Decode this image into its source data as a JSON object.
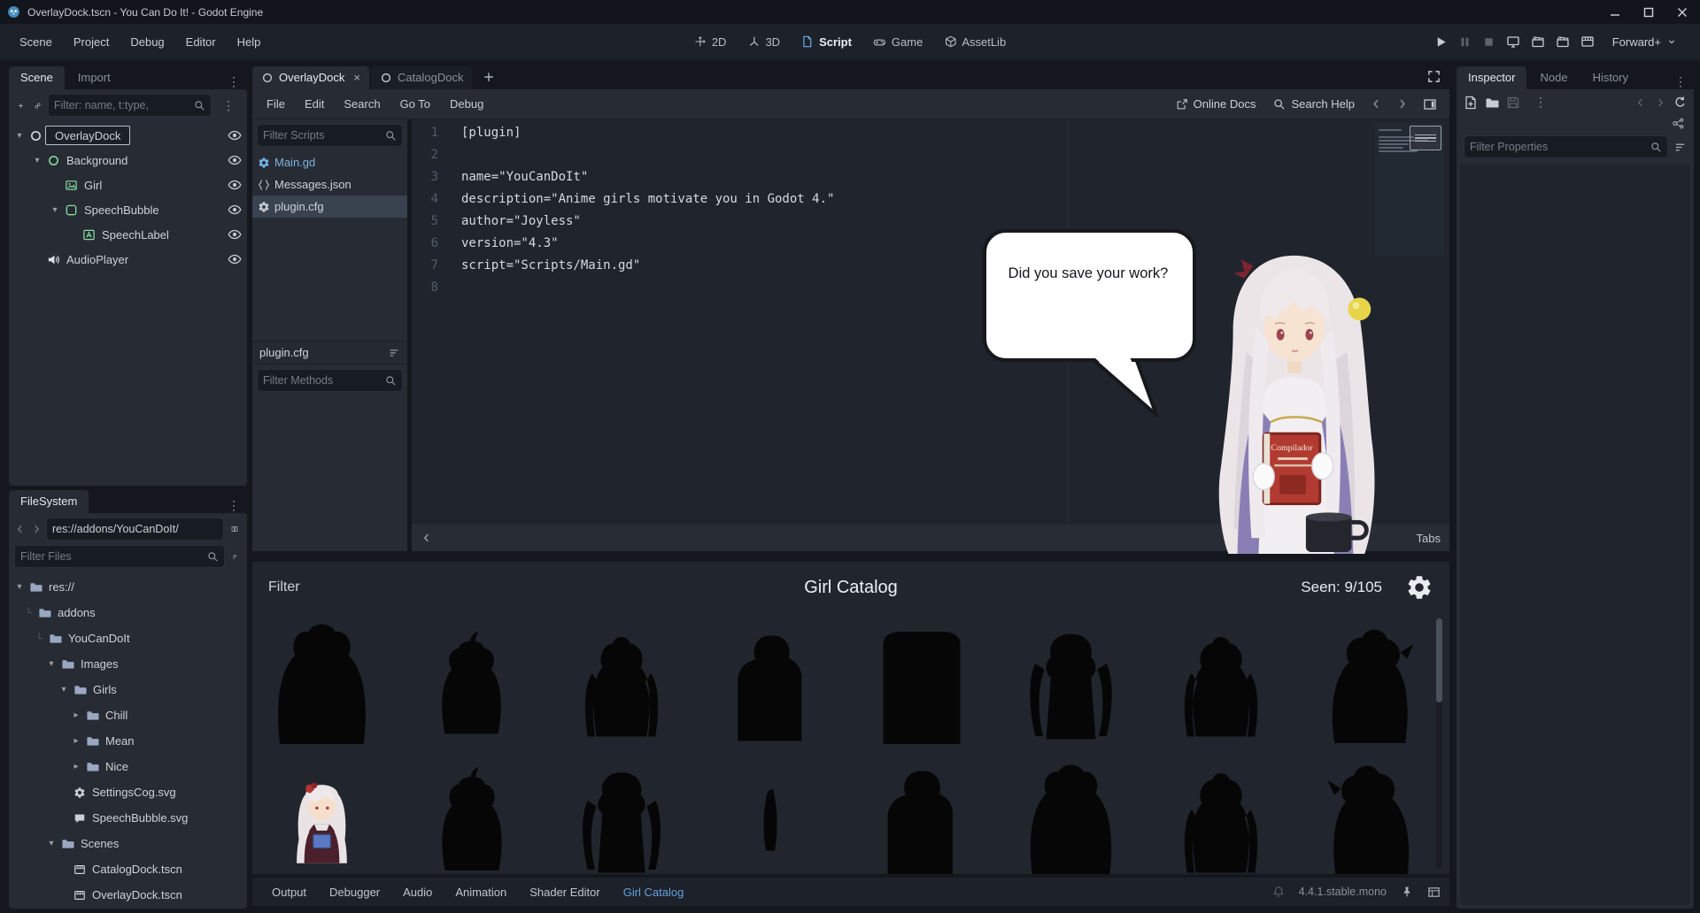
{
  "window": {
    "title": "OverlayDock.tscn - You Can Do It! - Godot Engine"
  },
  "menubar": {
    "items": [
      "Scene",
      "Project",
      "Debug",
      "Editor",
      "Help"
    ],
    "contexts": [
      "2D",
      "3D",
      "Script",
      "Game",
      "AssetLib"
    ],
    "active_context": "Script",
    "renderer": "Forward+"
  },
  "scene_dock": {
    "tabs": [
      "Scene",
      "Import"
    ],
    "active_tab": "Scene",
    "filter_placeholder": "Filter: name, t:type,",
    "nodes": [
      {
        "label": "OverlayDock"
      },
      {
        "label": "Background"
      },
      {
        "label": "Girl"
      },
      {
        "label": "SpeechBubble"
      },
      {
        "label": "SpeechLabel"
      },
      {
        "label": "AudioPlayer"
      }
    ]
  },
  "filesystem": {
    "title": "FileSystem",
    "path": "res://addons/YouCanDoIt/",
    "filter_placeholder": "Filter Files",
    "items": [
      {
        "label": "res://"
      },
      {
        "label": "addons"
      },
      {
        "label": "YouCanDoIt"
      },
      {
        "label": "Images"
      },
      {
        "label": "Girls"
      },
      {
        "label": "Chill"
      },
      {
        "label": "Mean"
      },
      {
        "label": "Nice"
      },
      {
        "label": "SettingsCog.svg"
      },
      {
        "label": "SpeechBubble.svg"
      },
      {
        "label": "Scenes"
      },
      {
        "label": "CatalogDock.tscn"
      },
      {
        "label": "OverlayDock.tscn"
      }
    ]
  },
  "script_editor": {
    "tabs": [
      {
        "label": "OverlayDock"
      },
      {
        "label": "CatalogDock"
      }
    ],
    "active_tab": "OverlayDock",
    "menus": [
      "File",
      "Edit",
      "Search",
      "Go To",
      "Debug"
    ],
    "online_docs": "Online Docs",
    "search_help": "Search Help",
    "filter_scripts_placeholder": "Filter Scripts",
    "scripts": [
      "Main.gd",
      "Messages.json",
      "plugin.cfg"
    ],
    "selected_script": "plugin.cfg",
    "script_name_label": "plugin.cfg",
    "filter_methods_placeholder": "Filter Methods",
    "code_lines": [
      "[plugin]",
      "",
      "name=\"YouCanDoIt\"",
      "description=\"Anime girls motivate you in Godot 4.\"",
      "author=\"Joyless\"",
      "version=\"4.3\"",
      "script=\"Scripts/Main.gd\"",
      ""
    ],
    "tabs_toggle_label": "Tabs"
  },
  "overlay_girl": {
    "speech": "Did you save your work?",
    "book_title": "Compilador"
  },
  "catalog": {
    "filter_label": "Filter",
    "title": "Girl Catalog",
    "seen": "Seen: 9/105"
  },
  "bottom_bar": {
    "items": [
      "Output",
      "Debugger",
      "Audio",
      "Animation",
      "Shader Editor",
      "Girl Catalog"
    ],
    "active": "Girl Catalog",
    "version": "4.4.1.stable.mono"
  },
  "inspector": {
    "tabs": [
      "Inspector",
      "Node",
      "History"
    ],
    "active_tab": "Inspector",
    "filter_placeholder": "Filter Properties"
  }
}
